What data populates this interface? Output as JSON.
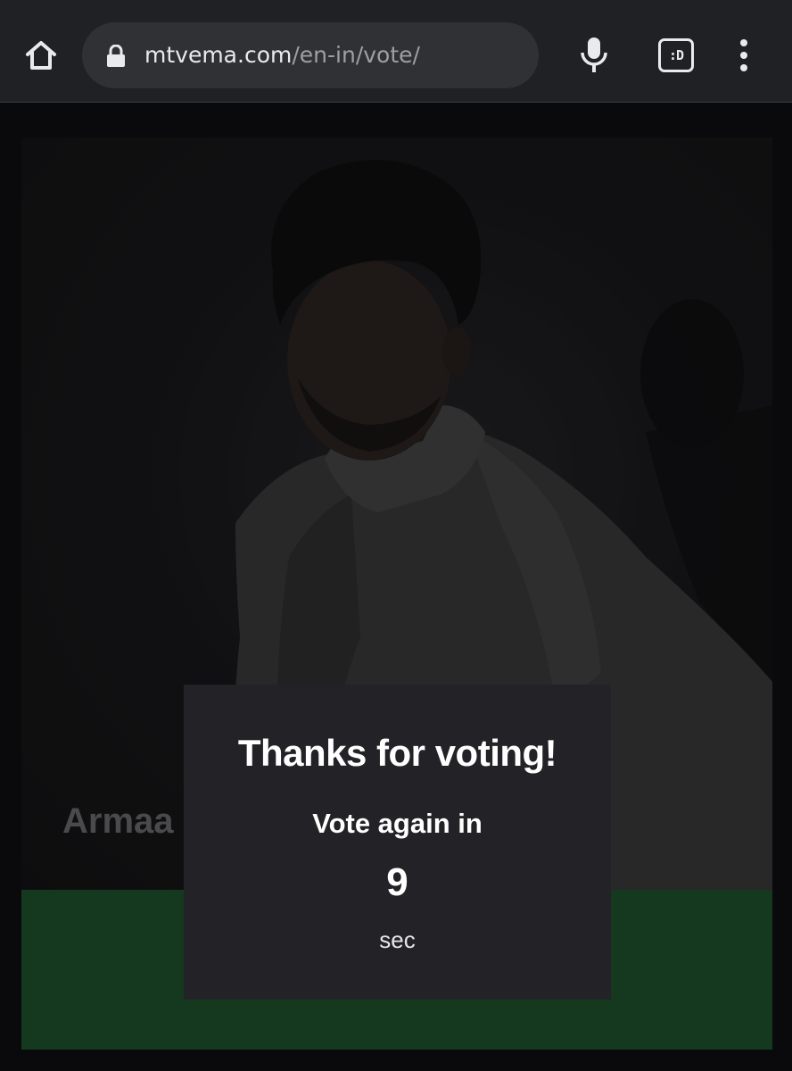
{
  "browser": {
    "url_host": "mtvema.com",
    "url_path": "/en-in/vote/",
    "tab_switcher_label": ":D"
  },
  "nominee": {
    "name": "Armaa"
  },
  "vote_modal": {
    "title": "Thanks for voting!",
    "subtitle": "Vote again in",
    "countdown": "9",
    "unit": "sec"
  },
  "colors": {
    "toolbar": "#202124",
    "omnibox": "#303134",
    "page_background": "#0a0a0c",
    "vote_bar": "#14391f",
    "modal": "#232327"
  },
  "icons": {
    "home": "home-icon",
    "lock": "lock-icon",
    "mic": "mic-icon",
    "tabs": "tab-switcher-icon",
    "menu": "more-vert-icon"
  }
}
